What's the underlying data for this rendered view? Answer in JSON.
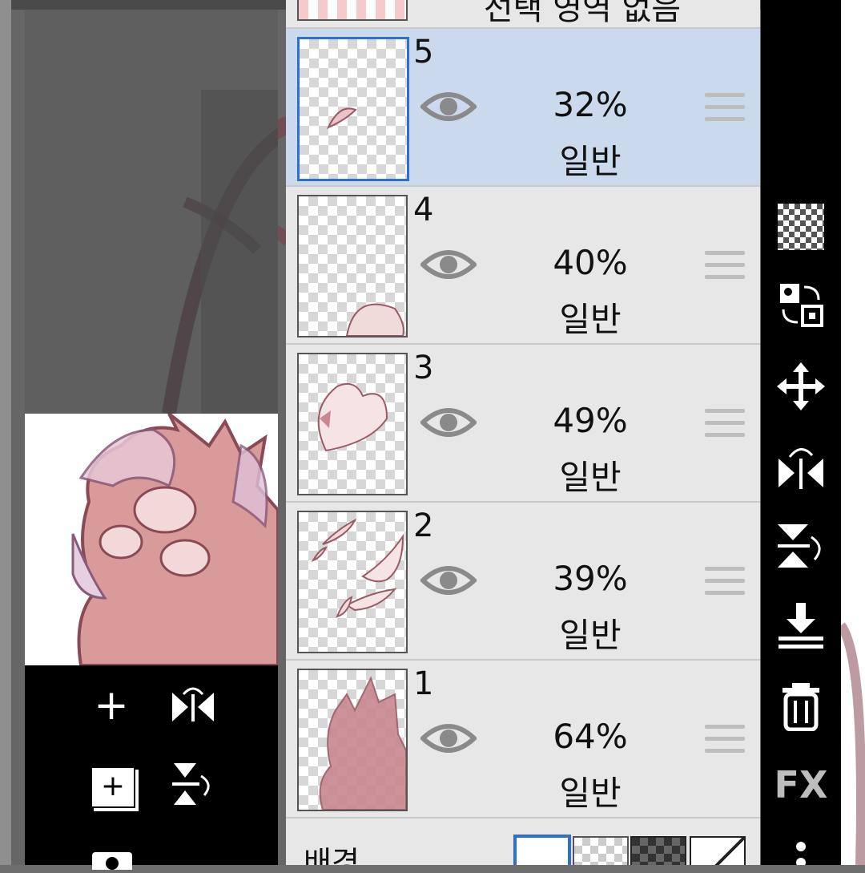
{
  "layer_panel": {
    "header_partial": "선택 영역 없음",
    "layers": [
      {
        "number": "5",
        "opacity": "32%",
        "blend": "일반",
        "selected": true
      },
      {
        "number": "4",
        "opacity": "40%",
        "blend": "일반",
        "selected": false
      },
      {
        "number": "3",
        "opacity": "49%",
        "blend": "일반",
        "selected": false
      },
      {
        "number": "2",
        "opacity": "39%",
        "blend": "일반",
        "selected": false
      },
      {
        "number": "1",
        "opacity": "64%",
        "blend": "일반",
        "selected": false
      }
    ],
    "background_label": "배경"
  },
  "right_toolbar": {
    "fx_label": "FX",
    "icons": [
      "transparency-icon",
      "swap-layer-icon",
      "move-icon",
      "flip-horizontal-icon",
      "flip-vertical-icon",
      "merge-down-icon",
      "trash-icon",
      "fx-icon",
      "more-icon"
    ]
  },
  "left_tools": {
    "icons": [
      "add-icon",
      "flip-horizontal-icon",
      "add-layer-icon",
      "flip-vertical-icon",
      "camera-icon"
    ]
  },
  "colors": {
    "selected_row": "#cbd9ec",
    "selected_border": "#2f6fd0",
    "panel_bg": "#e7e7e7",
    "toolbar_bg": "#000000"
  }
}
